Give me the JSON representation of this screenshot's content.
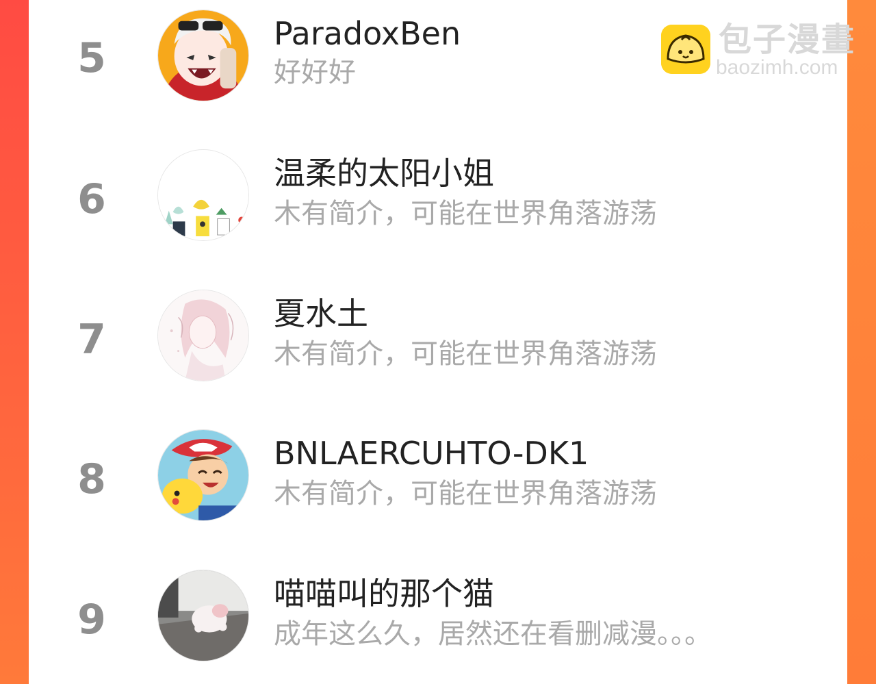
{
  "watermark": {
    "title": "包子漫畫",
    "url": "baozimh.com",
    "logo_icon": "bun-logo-icon",
    "logo_color": "#ffd21f"
  },
  "colors": {
    "background_gradient_start": "#ff4b43",
    "background_gradient_end": "#ff7a3a",
    "card": "#ffffff",
    "rank_text": "#8e8e8e",
    "name_text": "#222222",
    "bio_text": "#a9a9a9"
  },
  "ranking": [
    {
      "rank": "5",
      "name": "ParadoxBen",
      "bio": "好好好",
      "avatar": "anime-girl-sunglasses-avatar"
    },
    {
      "rank": "6",
      "name": "温柔的太阳小姐",
      "bio": "木有简介，可能在世界角落游荡",
      "avatar": "potted-plants-avatar"
    },
    {
      "rank": "7",
      "name": "夏水土",
      "bio": "木有简介，可能在世界角落游荡",
      "avatar": "sketch-girl-avatar"
    },
    {
      "rank": "8",
      "name": "BNLAERCUHTO-DK1",
      "bio": "木有简介，可能在世界角落游荡",
      "avatar": "boy-with-pikachu-avatar"
    },
    {
      "rank": "9",
      "name": "喵喵叫的那个猫",
      "bio": "成年这么久，居然还在看删减漫。。。",
      "avatar": "white-dog-photo-avatar"
    }
  ]
}
